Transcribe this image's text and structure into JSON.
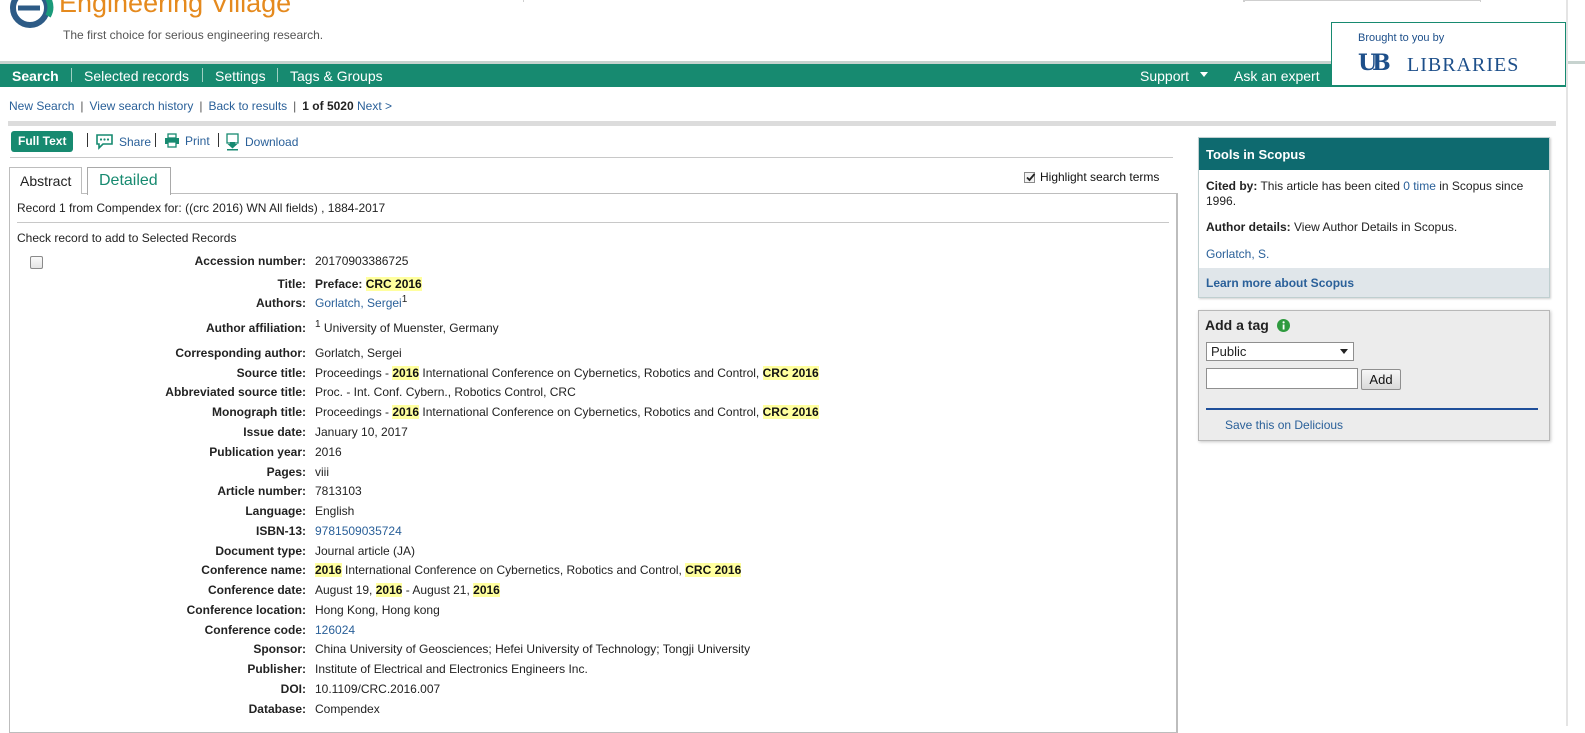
{
  "header": {
    "brand_name": "Engineering Village",
    "tagline": "The first choice for serious engineering research.",
    "brought_by": "Brought to you by",
    "library_mark": "UB",
    "library_name": "LIBRARIES"
  },
  "nav": {
    "items": [
      "Search",
      "Selected records",
      "Settings",
      "Tags & Groups"
    ],
    "support": "Support",
    "ask_expert": "Ask an expert"
  },
  "breadcrumb": {
    "new_search": "New Search",
    "history": "View search history",
    "back": "Back to results",
    "position": "1 of 5020",
    "next": "Next >"
  },
  "toolbar": {
    "full_text": "Full Text",
    "share": "Share",
    "print": "Print",
    "download": "Download"
  },
  "tabs": {
    "abstract": "Abstract",
    "detailed": "Detailed",
    "highlight": "Highlight search terms"
  },
  "record": {
    "from": "Record 1 from Compendex for: ((crc 2016) WN All fields) , 1884-2017",
    "check_label": "Check record to add to Selected Records",
    "fields": [
      {
        "label": "Accession number:",
        "parts": [
          {
            "t": "20170903386725"
          }
        ]
      },
      {
        "label": "Title:",
        "parts": [
          {
            "t": "Preface: ",
            "b": true
          },
          {
            "t": "CRC 2016",
            "h": true
          }
        ]
      },
      {
        "label": "Authors:",
        "parts": [
          {
            "t": "Gorlatch, Sergei",
            "link": true
          },
          {
            "t": "1",
            "sup": true
          }
        ]
      },
      {
        "label": "Author affiliation:",
        "parts": [
          {
            "t": "1",
            "sup": true
          },
          {
            "t": " University of Muenster, Germany"
          }
        ]
      },
      {
        "label": "Corresponding author:",
        "parts": [
          {
            "t": "Gorlatch, Sergei"
          }
        ]
      },
      {
        "label": "Source title:",
        "parts": [
          {
            "t": "Proceedings - "
          },
          {
            "t": "2016",
            "h": true
          },
          {
            "t": " International Conference on Cybernetics, Robotics and Control, "
          },
          {
            "t": "CRC 2016",
            "h": true
          }
        ]
      },
      {
        "label": "Abbreviated source title:",
        "parts": [
          {
            "t": "Proc. - Int. Conf. Cybern., Robotics Control, CRC"
          }
        ]
      },
      {
        "label": "Monograph title:",
        "parts": [
          {
            "t": "Proceedings - "
          },
          {
            "t": "2016",
            "h": true
          },
          {
            "t": " International Conference on Cybernetics, Robotics and Control, "
          },
          {
            "t": "CRC 2016",
            "h": true
          }
        ]
      },
      {
        "label": "Issue date:",
        "parts": [
          {
            "t": "January 10, 2017"
          }
        ]
      },
      {
        "label": "Publication year:",
        "parts": [
          {
            "t": "2016"
          }
        ]
      },
      {
        "label": "Pages:",
        "parts": [
          {
            "t": "viii"
          }
        ]
      },
      {
        "label": "Article number:",
        "parts": [
          {
            "t": "7813103"
          }
        ]
      },
      {
        "label": "Language:",
        "parts": [
          {
            "t": "English"
          }
        ]
      },
      {
        "label": "ISBN-13:",
        "parts": [
          {
            "t": "9781509035724",
            "link": true
          }
        ]
      },
      {
        "label": "Document type:",
        "parts": [
          {
            "t": "Journal article (JA)"
          }
        ]
      },
      {
        "label": "Conference name:",
        "parts": [
          {
            "t": "2016",
            "h": true
          },
          {
            "t": " International Conference on Cybernetics, Robotics and Control, "
          },
          {
            "t": "CRC 2016",
            "h": true
          }
        ]
      },
      {
        "label": "Conference date:",
        "parts": [
          {
            "t": "August 19, "
          },
          {
            "t": "2016",
            "h": true
          },
          {
            "t": " - August 21, "
          },
          {
            "t": "2016",
            "h": true
          }
        ]
      },
      {
        "label": "Conference location:",
        "parts": [
          {
            "t": "Hong Kong, Hong kong"
          }
        ]
      },
      {
        "label": "Conference code:",
        "parts": [
          {
            "t": "126024",
            "link": true
          }
        ]
      },
      {
        "label": "Sponsor:",
        "parts": [
          {
            "t": "China University of Geosciences; Hefei University of Technology; Tongji University"
          }
        ]
      },
      {
        "label": "Publisher:",
        "parts": [
          {
            "t": "Institute of Electrical and Electronics Engineers Inc."
          }
        ]
      },
      {
        "label": "DOI:",
        "parts": [
          {
            "t": "10.1109/CRC.2016.007"
          }
        ]
      },
      {
        "label": "Database:",
        "parts": [
          {
            "t": "Compendex"
          }
        ]
      }
    ]
  },
  "scopus": {
    "title": "Tools in Scopus",
    "cited_label": "Cited by:",
    "cited_pre": " This article has been cited ",
    "cited_link": "0 time",
    "cited_post": " in Scopus since 1996.",
    "author_label": "Author details:",
    "author_text": " View Author Details in Scopus.",
    "author_name": "Gorlatch, S.",
    "learn_more": "Learn more about Scopus"
  },
  "tag": {
    "title": "Add a tag",
    "select_value": "Public",
    "input_value": "",
    "add_label": "Add",
    "delicious": "Save this on Delicious"
  },
  "colors": {
    "brand_green": "#178a70",
    "brand_orange": "#e58a1e",
    "scopus_teal": "#0e6a6f",
    "highlight": "#ffff9e",
    "link": "#2a6099"
  }
}
